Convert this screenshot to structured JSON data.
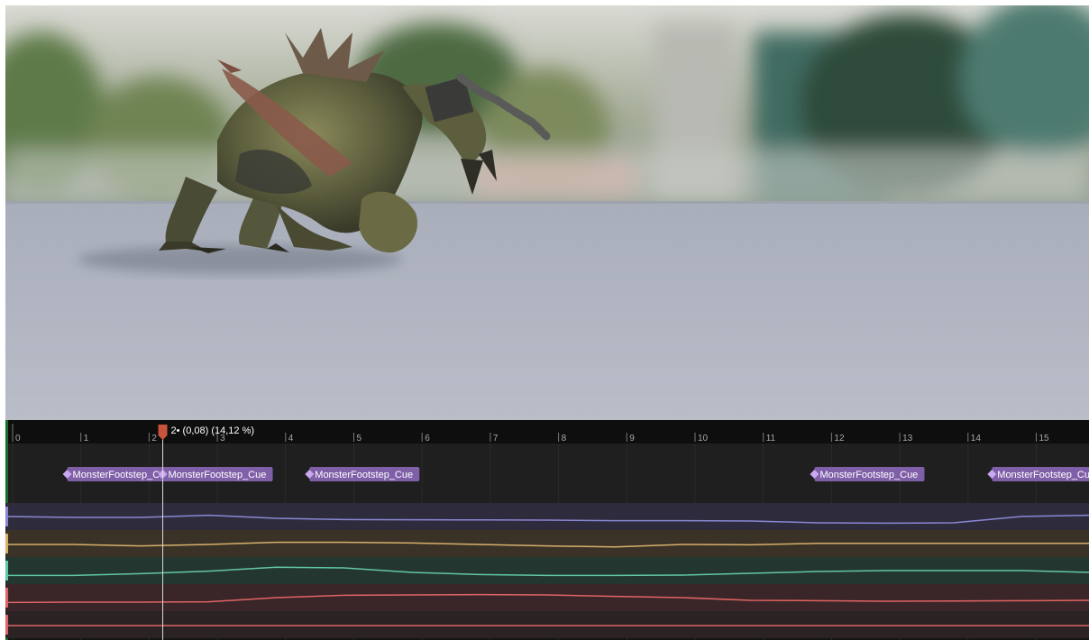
{
  "viewport": {
    "sky_color": "#a9b0a6",
    "floor_color": "#b3b8c4",
    "subject": "creature-character"
  },
  "timeline": {
    "frames": [
      "0",
      "1",
      "2",
      "3",
      "4",
      "5",
      "6",
      "7",
      "8",
      "9",
      "10",
      "11",
      "12",
      "13",
      "14",
      "15"
    ],
    "playhead": {
      "label": "2• (0,08) (14,12 %)",
      "frame": 2.2,
      "color": "#c9543c"
    },
    "notifies": [
      {
        "label": "MonsterFootstep_Cue",
        "frame": 0.8
      },
      {
        "label": "MonsterFootstep_Cue",
        "frame": 2.2
      },
      {
        "label": "MonsterFootstep_Cue",
        "frame": 4.35
      },
      {
        "label": "MonsterFootstep_Cue",
        "frame": 11.75
      },
      {
        "label": "MonsterFootstep_Cue",
        "frame": 14.35
      }
    ],
    "notify_color": "#7f5fa8",
    "curves": [
      {
        "color": "#8a87d4",
        "band": "#2e2c3c",
        "level": [
          0.55,
          0.5,
          0.5,
          0.62,
          0.45,
          0.38,
          0.37,
          0.36,
          0.35,
          0.32,
          0.32,
          0.3,
          0.2,
          0.18,
          0.2,
          0.55,
          0.62
        ]
      },
      {
        "color": "#d6b06c",
        "band": "#3a3226",
        "level": [
          0.5,
          0.5,
          0.42,
          0.5,
          0.62,
          0.62,
          0.58,
          0.5,
          0.42,
          0.36,
          0.5,
          0.48,
          0.56,
          0.56,
          0.56,
          0.56,
          0.56
        ]
      },
      {
        "color": "#62c7a8",
        "band": "#233630",
        "level": [
          0.28,
          0.28,
          0.38,
          0.52,
          0.74,
          0.7,
          0.45,
          0.33,
          0.28,
          0.28,
          0.3,
          0.4,
          0.5,
          0.55,
          0.55,
          0.55,
          0.45
        ]
      },
      {
        "color": "#e06464",
        "band": "#3a2628",
        "level": [
          0.28,
          0.3,
          0.3,
          0.32,
          0.55,
          0.68,
          0.7,
          0.72,
          0.7,
          0.62,
          0.55,
          0.4,
          0.38,
          0.35,
          0.36,
          0.38,
          0.4
        ]
      },
      {
        "color": "#e06464",
        "band": "#2b2224",
        "level": [
          0.5,
          0.5,
          0.5,
          0.5,
          0.5,
          0.5,
          0.5,
          0.5,
          0.5,
          0.5,
          0.5,
          0.5,
          0.5,
          0.5,
          0.5,
          0.5,
          0.5
        ]
      }
    ]
  }
}
